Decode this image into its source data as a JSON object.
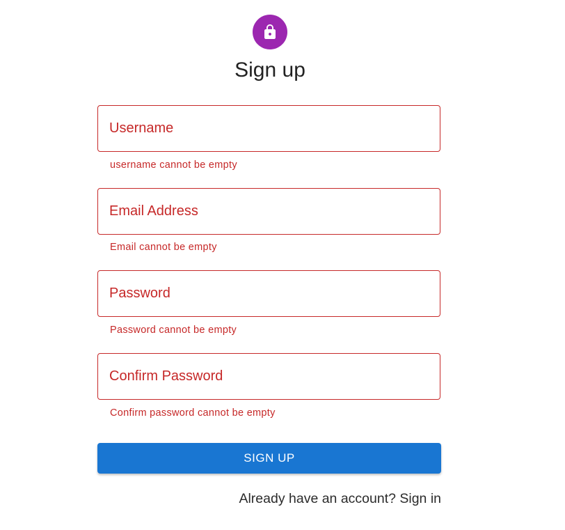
{
  "header": {
    "icon": "lock-icon",
    "title": "Sign up"
  },
  "form": {
    "fields": [
      {
        "placeholder": "Username",
        "value": "",
        "error": "username cannot be empty"
      },
      {
        "placeholder": "Email Address",
        "value": "",
        "error": "Email cannot be empty"
      },
      {
        "placeholder": "Password",
        "value": "",
        "error": "Password cannot be empty"
      },
      {
        "placeholder": "Confirm Password",
        "value": "",
        "error": "Confirm password cannot be empty"
      }
    ],
    "submit_label": "SIGN UP",
    "signin_link": "Already have an account? Sign in"
  },
  "colors": {
    "avatar": "#9c27b0",
    "error": "#c62828",
    "primary": "#1976d2"
  }
}
